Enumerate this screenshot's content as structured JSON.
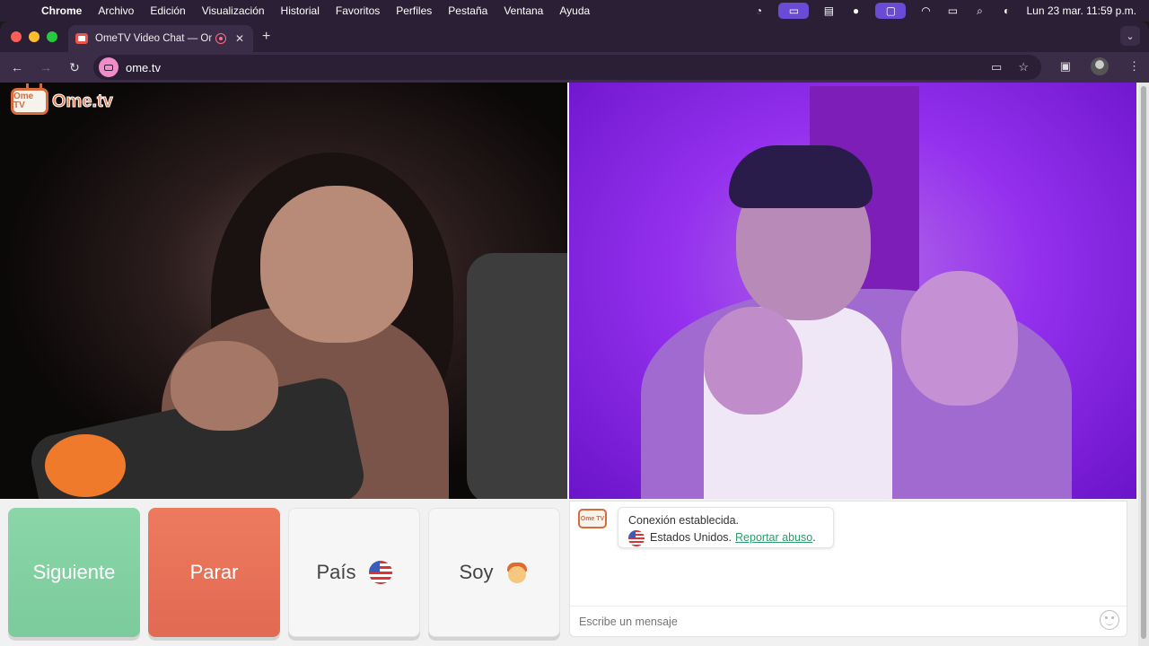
{
  "menubar": {
    "app_name": "Chrome",
    "items": [
      "Archivo",
      "Edición",
      "Visualización",
      "Historial",
      "Favoritos",
      "Perfiles",
      "Pestaña",
      "Ventana",
      "Ayuda"
    ],
    "clock": "Lun 23 mar.  11:59 p.m."
  },
  "tab": {
    "title": "OmeTV Video Chat — Ome",
    "close": "✕",
    "new_tab": "+"
  },
  "toolbar": {
    "back": "←",
    "forward": "→",
    "reload": "↻",
    "url": "ome.tv"
  },
  "logo": {
    "tv_text": "Ome TV",
    "wordmark": "Ome.tv"
  },
  "buttons": {
    "next": "Siguiente",
    "stop": "Parar",
    "country": "País",
    "gender": "Soy"
  },
  "chat": {
    "logo_text": "Ome TV",
    "status": "Conexión establecida.",
    "country_text": "Estados Unidos.",
    "report_link": "Reportar abuso",
    "report_suffix": ".",
    "input_placeholder": "Escribe un mensaje"
  },
  "colors": {
    "next_button": "#7ccb9c",
    "stop_button": "#e06a52",
    "link": "#2f9a6a",
    "brand": "#d86a3c"
  }
}
